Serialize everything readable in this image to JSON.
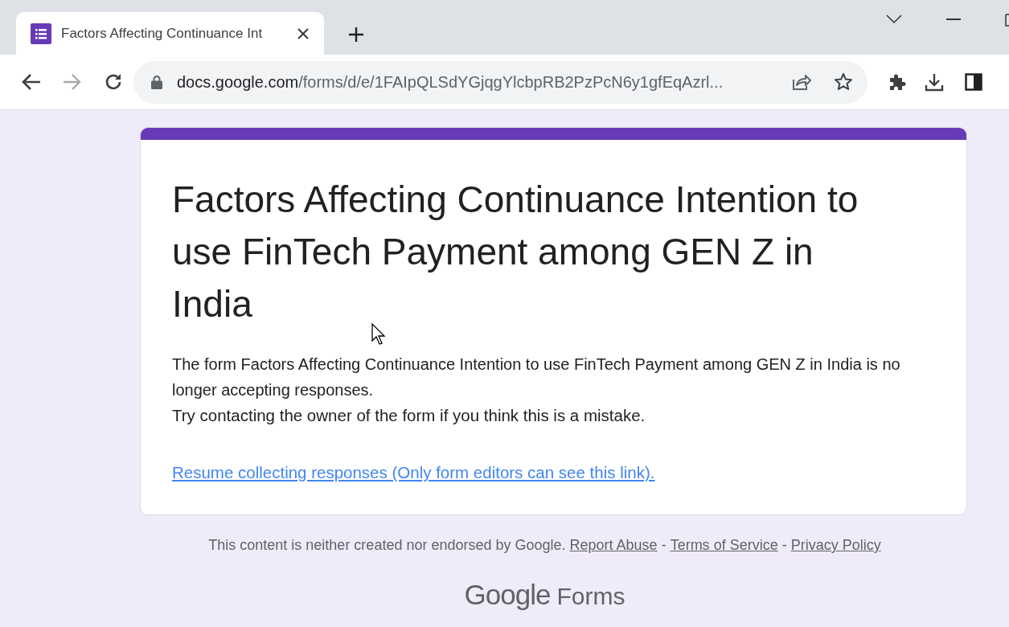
{
  "browser": {
    "tab": {
      "title": "Factors Affecting Continuance Int",
      "selected": true
    },
    "address": {
      "domain": "docs.google.com",
      "path": "/forms/d/e/1FAIpQLSdYGjqgYlcbpRB2PzPcN6y1gfEqAzrl..."
    }
  },
  "form": {
    "title": "Factors Affecting Continuance Intention to use FinTech Payment among GEN Z in India",
    "message": "The form Factors Affecting Continuance Intention to use FinTech Payment among GEN Z in India is no longer accepting responses.",
    "hint": "Try contacting the owner of the form if you think this is a mistake.",
    "link": "Resume collecting responses (Only form editors can see this link)."
  },
  "footer": {
    "notice": "This content is neither created nor endorsed by Google.",
    "links": [
      {
        "label": "Report Abuse",
        "separator": "-"
      },
      {
        "label": "Terms of Service",
        "separator": "-"
      },
      {
        "label": "Privacy Policy"
      }
    ]
  },
  "logo": {
    "brand": "Google",
    "product": "Forms"
  }
}
